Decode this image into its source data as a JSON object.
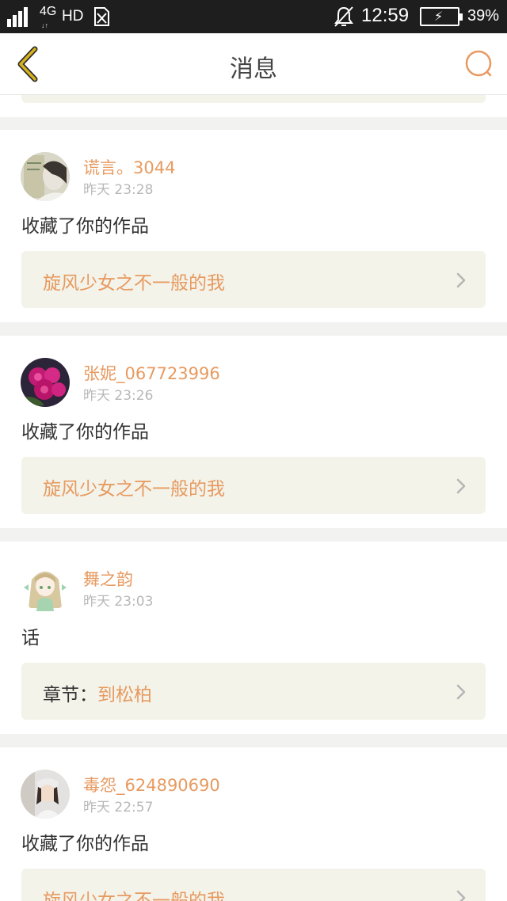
{
  "status_bar": {
    "network": "4G",
    "hd": "HD",
    "time": "12:59",
    "battery_percent": "39%"
  },
  "header": {
    "title": "消息"
  },
  "colors": {
    "accent": "#e79a60",
    "back_arrow": "#c9a21a",
    "card_bg": "#f3f3ea"
  },
  "messages": [
    {
      "username": "谎言。3044",
      "time": "昨天 23:28",
      "text": "收藏了你的作品",
      "card_prefix": "",
      "card_title": "旋风少女之不一般的我",
      "avatar": "avatar-photo-light"
    },
    {
      "username": "张妮_067723996",
      "time": "昨天 23:26",
      "text": "收藏了你的作品",
      "card_prefix": "",
      "card_title": "旋风少女之不一般的我",
      "avatar": "avatar-flowers"
    },
    {
      "username": "舞之韵",
      "time": "昨天 23:03",
      "text": "话",
      "card_prefix": "章节：",
      "card_title": "到松柏",
      "avatar": "avatar-anime-girl"
    },
    {
      "username": "毒怨_624890690",
      "time": "昨天 22:57",
      "text": "收藏了你的作品",
      "card_prefix": "",
      "card_title": "旋风少女之不一般的我",
      "avatar": "avatar-photo-girl"
    }
  ]
}
